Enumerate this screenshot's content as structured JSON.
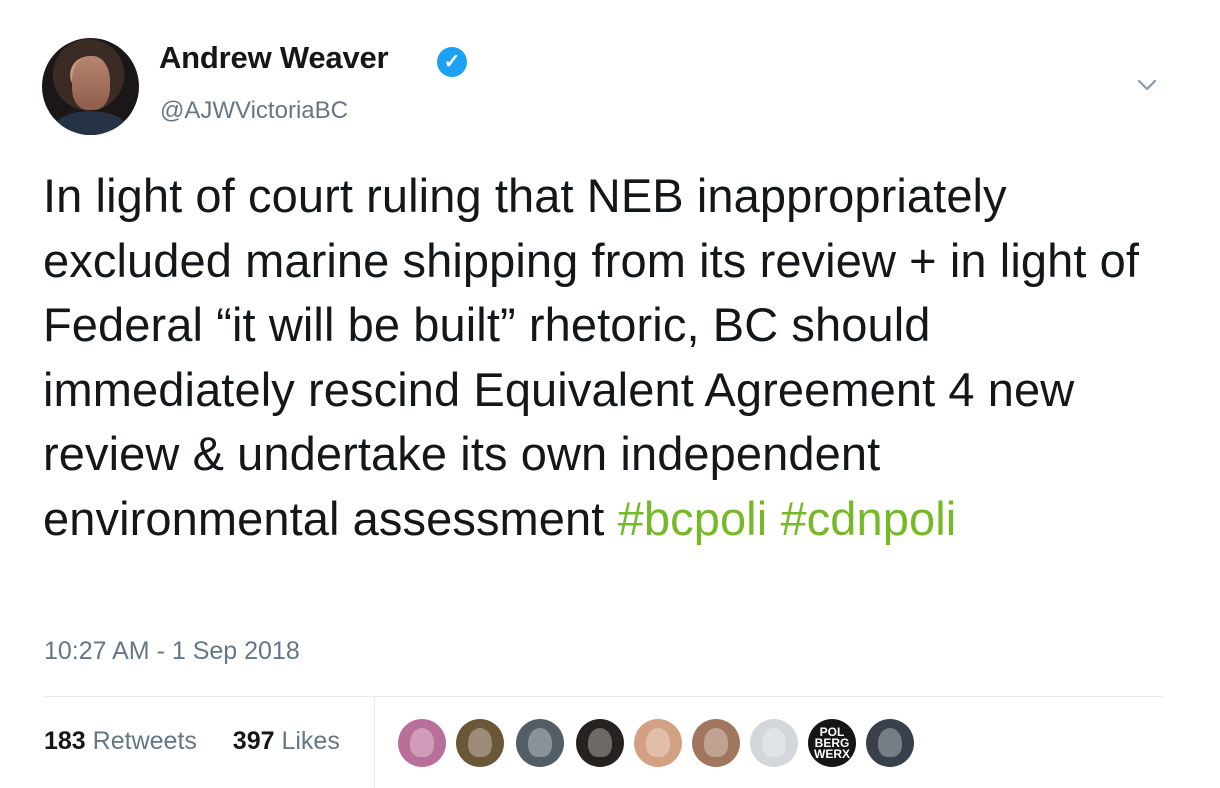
{
  "author": {
    "name": "Andrew Weaver",
    "handle": "@AJWVictoriaBC",
    "verified_mark": "✓",
    "avatar_icon": "profile-photo"
  },
  "tweet": {
    "text": "In light of court ruling that NEB inappropriately excluded marine shipping from its review + in light of Federal “it will be built” rhetoric, BC should immediately rescind Equivalent Agreement 4 new review & undertake its own independent environmental assessment",
    "hashtags": [
      "#bcpoli",
      "#cdnpoli"
    ]
  },
  "timestamp": "10:27 AM - 1 Sep 2018",
  "stats": {
    "retweets": {
      "count": "183",
      "label": "Retweets"
    },
    "likes": {
      "count": "397",
      "label": "Likes"
    }
  },
  "liker_avatars": [
    {
      "background": "#b86f99",
      "text": ""
    },
    {
      "background": "#6c5638",
      "text": ""
    },
    {
      "background": "#535d66",
      "text": ""
    },
    {
      "background": "#27221f",
      "text": ""
    },
    {
      "background": "#d2a082",
      "text": ""
    },
    {
      "background": "#a1765f",
      "text": ""
    },
    {
      "background": "#d3d7db",
      "text": ""
    },
    {
      "background": "#151515",
      "text": "POL BERG WERX"
    },
    {
      "background": "#37404b",
      "text": ""
    }
  ],
  "colors": {
    "text": "#14171a",
    "secondary": "#657786",
    "hashtag": "#75b926",
    "verified": "#1da1f2",
    "divider": "#e6ecf0"
  }
}
